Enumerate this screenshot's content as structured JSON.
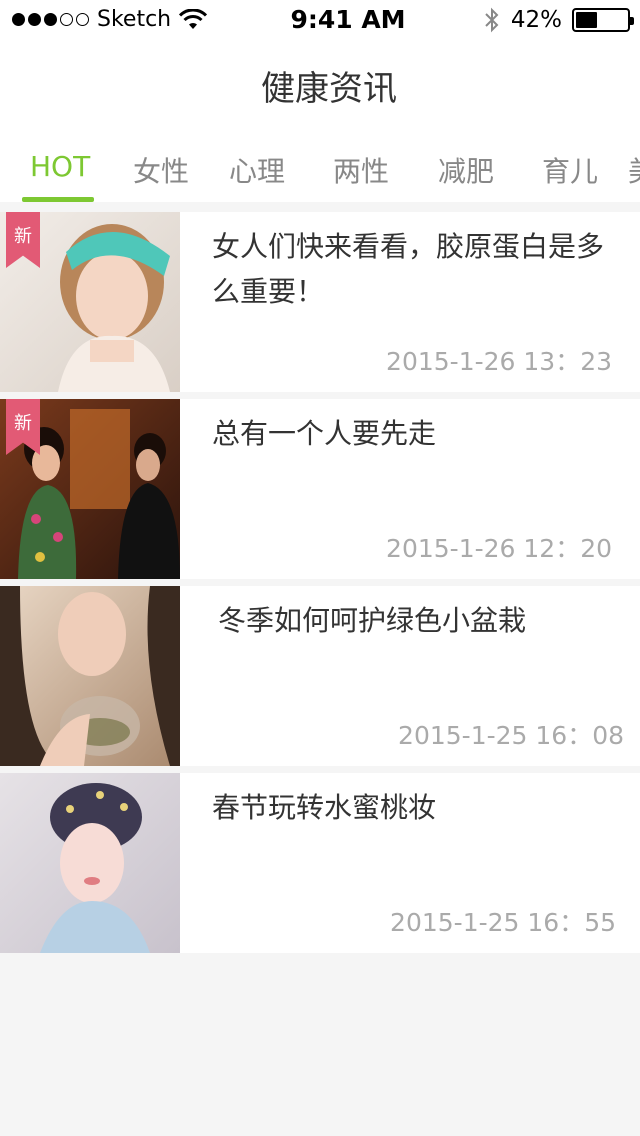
{
  "status_bar": {
    "carrier": "Sketch",
    "time": "9:41 AM",
    "battery_percent_label": "42%",
    "battery_level": 0.42
  },
  "header": {
    "title": "健康资讯"
  },
  "tabs": [
    {
      "label": "HOT",
      "active": true
    },
    {
      "label": "女性",
      "active": false
    },
    {
      "label": "心理",
      "active": false
    },
    {
      "label": "两性",
      "active": false
    },
    {
      "label": "减肥",
      "active": false
    },
    {
      "label": "育儿",
      "active": false
    },
    {
      "label": "美",
      "active": false
    }
  ],
  "accent_color": "#7dc832",
  "badge_color": "#e25a75",
  "articles": [
    {
      "title": "女人们快来看看，胶原蛋白是多么重要！",
      "time": "2015-1-26  13：23",
      "badge": "新"
    },
    {
      "title": "总有一个人要先走",
      "time": "2015-1-26  12：20",
      "badge": "新"
    },
    {
      "title": "冬季如何呵护绿色小盆栽",
      "time": "2015-1-25 16：08"
    },
    {
      "title": "春节玩转水蜜桃妆",
      "time": "2015-1-25  16：55"
    }
  ]
}
